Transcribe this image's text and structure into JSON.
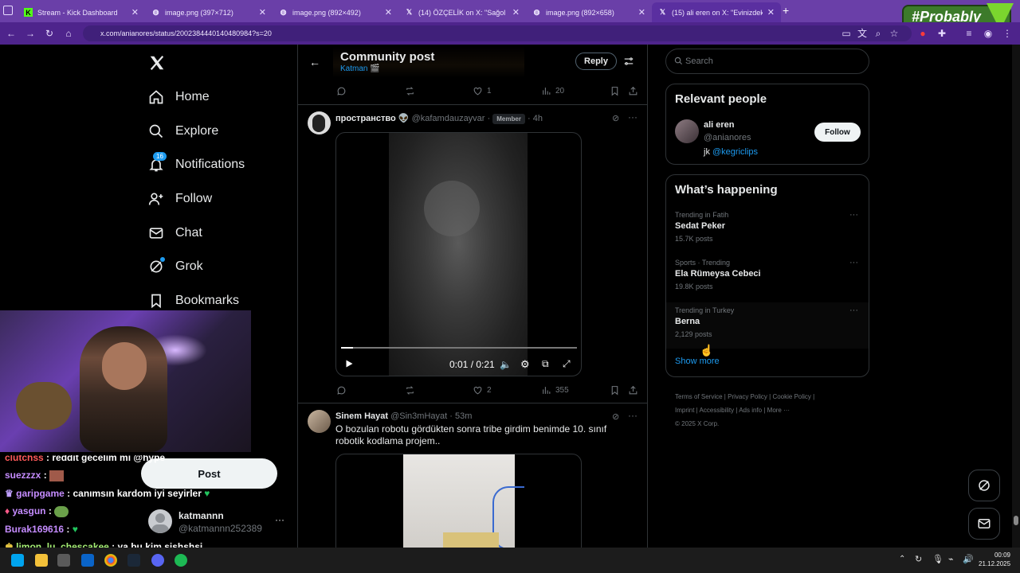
{
  "browser": {
    "tabs": [
      {
        "title": "Stream - Kick Dashboard",
        "icon": "kick-icon"
      },
      {
        "title": "image.png (397×712)",
        "icon": "globe-icon"
      },
      {
        "title": "image.png (892×492)",
        "icon": "globe-icon"
      },
      {
        "title": "(14) ÖZÇELİK on X: \"Sağol abi g",
        "icon": "x-icon"
      },
      {
        "title": "image.png (892×658)",
        "icon": "globe-icon"
      },
      {
        "title": "(15) ali eren on X: \"Evinizdeki el",
        "icon": "x-icon"
      }
    ],
    "url": "x.com/anianores/status/2002384440140480984?s=20",
    "overlay_badge": "#Probably"
  },
  "left_nav": {
    "items": [
      {
        "label": "Home",
        "icon": "home-icon"
      },
      {
        "label": "Explore",
        "icon": "search-icon"
      },
      {
        "label": "Notifications",
        "icon": "bell-icon",
        "badge": "16"
      },
      {
        "label": "Follow",
        "icon": "person-add-icon"
      },
      {
        "label": "Chat",
        "icon": "mail-icon"
      },
      {
        "label": "Grok",
        "icon": "grok-icon"
      },
      {
        "label": "Bookmarks",
        "icon": "bookmark-icon"
      }
    ],
    "post_button": "Post",
    "account": {
      "name": "katmannn",
      "handle": "@katmannn252389"
    }
  },
  "center": {
    "header": {
      "title": "Community post",
      "subtitle": "Katman 🎬",
      "reply_button": "Reply"
    },
    "top_actions": {
      "likes": "1",
      "views": "20"
    },
    "post1": {
      "name": "пространство",
      "handle": "@kafamdauzayvar",
      "badge": "Member",
      "time": "4h",
      "video_time": "0:01 / 0:21",
      "video_progress": 0.05,
      "likes": "2",
      "views": "355"
    },
    "post2": {
      "name": "Sinem Hayat",
      "handle": "@Sin3mHayat",
      "time": "53m",
      "text": "O bozulan robotu gördükten sonra tribe girdim benimde 10. sınıf robotik kodlama projem.."
    }
  },
  "right": {
    "search_placeholder": "Search",
    "relevant": {
      "title": "Relevant people",
      "name": "ali eren",
      "handle": "@anianores",
      "bio_prefix": "jk",
      "bio_link": "@kegriclips",
      "follow_button": "Follow"
    },
    "happening": {
      "title": "What’s happening",
      "trends": [
        {
          "context": "Trending in Fatih",
          "name": "Sedat Peker",
          "posts": "15.7K posts"
        },
        {
          "context": "Sports · Trending",
          "name": "Ela Rümeysa Cebeci",
          "posts": "19.8K posts"
        },
        {
          "context": "Trending in Turkey",
          "name": "Berna",
          "posts": "2,129 posts"
        }
      ],
      "show_more": "Show more"
    },
    "footer": [
      "Terms of Service",
      "Privacy Policy",
      "Cookie Policy",
      "Imprint",
      "Accessibility",
      "Ads info",
      "More ···",
      "© 2025 X Corp."
    ]
  },
  "stream_chat": [
    {
      "user": "clutchss",
      "user_color": "#ff5a5a",
      "message": "reddit gecelim mi @hype"
    },
    {
      "user": "suezzzx",
      "user_color": "#c58cff",
      "message": ""
    },
    {
      "user": "garipgame",
      "user_color": "#c58cff",
      "message": "canımsın kardom iyi seyirler"
    },
    {
      "user": "yasgun",
      "user_color": "#c58cff",
      "message": ""
    },
    {
      "user": "Burak169616",
      "user_color": "#c58cff",
      "message": ""
    },
    {
      "user": "limon_lu_chescakee",
      "user_color": "#a6f075",
      "message": "ya bu kim sjshshsj"
    }
  ],
  "taskbar": {
    "time": "00:09",
    "date": "21.12.2025"
  }
}
